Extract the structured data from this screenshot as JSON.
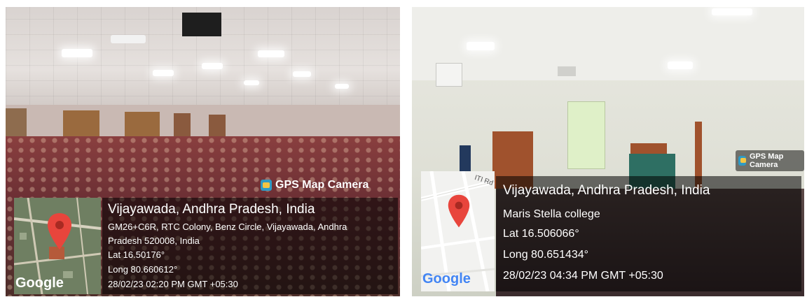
{
  "photos": [
    {
      "app_badge": "GPS Map Camera",
      "location_title": "Vijayawada, Andhra Pradesh, India",
      "address_line_1": "GM26+C6R, RTC Colony, Benz Circle, Vijayawada, Andhra",
      "address_line_2": "Pradesh 520008, India",
      "lat": "Lat 16.50176°",
      "long": "Long 80.660612°",
      "timestamp": "28/02/23 02:20 PM GMT +05:30",
      "map_brand": "Google"
    },
    {
      "app_badge": "GPS Map Camera",
      "location_title": "Vijayawada, Andhra Pradesh, India",
      "place_name": "Maris Stella college",
      "lat": "Lat 16.506066°",
      "long": "Long 80.651434°",
      "timestamp": "28/02/23 04:34 PM GMT +05:30",
      "map_brand": "Google",
      "map_road_label": "ITI Rd"
    }
  ],
  "colors": {
    "pin": "#e8453c",
    "google_blue": "#4285f4",
    "overlay": "#000000"
  },
  "icons": [
    "camera-icon",
    "map-pin-icon"
  ]
}
